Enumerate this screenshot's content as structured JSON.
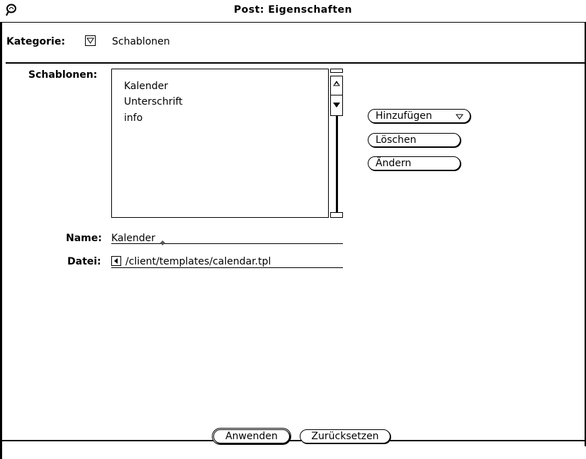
{
  "window": {
    "title": "Post: Eigenschaften"
  },
  "category": {
    "label": "Kategorie:",
    "value": "Schablonen"
  },
  "templates": {
    "label": "Schablonen:",
    "items": [
      "Kalender",
      "Unterschrift",
      "info"
    ]
  },
  "buttons": {
    "add": "Hinzufügen",
    "delete": "Löschen",
    "edit": "Ändern",
    "apply": "Anwenden",
    "reset": "Zurücksetzen"
  },
  "fields": {
    "name_label": "Name:",
    "name_value": "Kalender",
    "file_label": "Datei:",
    "file_value": "/client/templates/calendar.tpl"
  },
  "icons": {
    "window_menu": "window-menu-icon",
    "menu_triangle": "triangle-down-icon",
    "scroll_left": "scroll-left-icon"
  }
}
